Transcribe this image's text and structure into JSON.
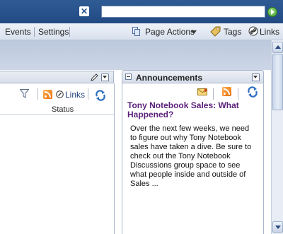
{
  "topbar": {
    "clear_label": "✕",
    "search_value": "",
    "search_placeholder": ""
  },
  "nav": {
    "events": "Events",
    "settings": "Settings",
    "page_actions": "Page Actions",
    "tags": "Tags",
    "links": "Links"
  },
  "left_panel": {
    "links": "Links",
    "status_column": "Status"
  },
  "announcements": {
    "title": "Announcements",
    "post_title": "Tony Notebook Sales: What Happened?",
    "post_text": "Over the next few weeks, we need to figure out why Tony Notebook sales have taken a dive. Be sure to check out the Tony Notebook Discussions group space to see what people inside and outside of Sales ..."
  },
  "colors": {
    "topbar": "#2a5590",
    "post_title": "#5a1f7a",
    "rss": "#f08a24"
  }
}
